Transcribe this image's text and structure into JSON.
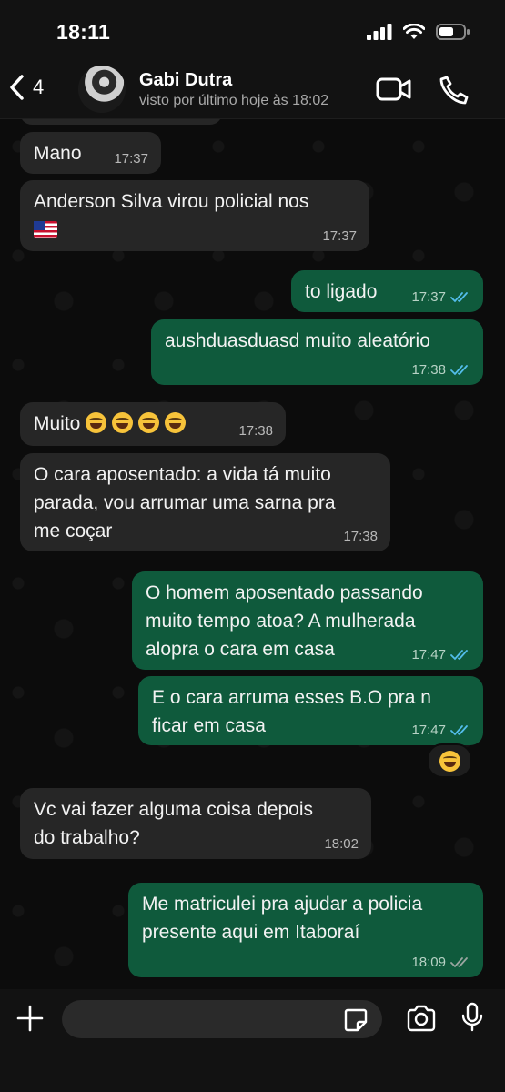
{
  "status": {
    "time": "18:11"
  },
  "header": {
    "back_count": "4",
    "contact_name": "Gabi Dutra",
    "contact_status": "visto por último hoje às 18:02"
  },
  "messages": [
    {
      "dir": "in",
      "text": "Mano",
      "time": "17:37"
    },
    {
      "dir": "in",
      "text": "Anderson Silva virou policial nos",
      "time": "17:37",
      "emoji": "us-flag"
    },
    {
      "dir": "out",
      "text": "to ligado",
      "time": "17:37",
      "read": true
    },
    {
      "dir": "out",
      "text": "aushduasduasd muito aleatório",
      "time": "17:38",
      "read": true
    },
    {
      "dir": "in",
      "text": "Muito",
      "time": "17:38",
      "emoji": "rofl-x4"
    },
    {
      "dir": "in",
      "text": "O cara aposentado: a vida tá muito\nparada, vou arrumar uma sarna pra\nme coçar",
      "time": "17:38"
    },
    {
      "dir": "out",
      "text": "O homem aposentado passando\nmuito tempo atoa? A mulherada\nalopra o cara em casa",
      "time": "17:47",
      "read": true
    },
    {
      "dir": "out",
      "text": "E o cara arruma esses B.O pra n\nficar em casa",
      "time": "17:47",
      "read": true,
      "reaction": "joy-emoji"
    },
    {
      "dir": "in",
      "text": "Vc vai fazer alguma coisa depois\ndo trabalho?",
      "time": "18:02"
    },
    {
      "dir": "out",
      "text": "Me matriculei pra ajudar a policia\npresente aqui em Itaboraí",
      "time": "18:09",
      "read": false
    }
  ],
  "input": {
    "value": "",
    "placeholder": ""
  },
  "colors": {
    "incoming": "#262626",
    "outgoing": "#0f5a3c",
    "read_tick": "#53bdeb",
    "sent_tick": "#9aa5a0"
  }
}
